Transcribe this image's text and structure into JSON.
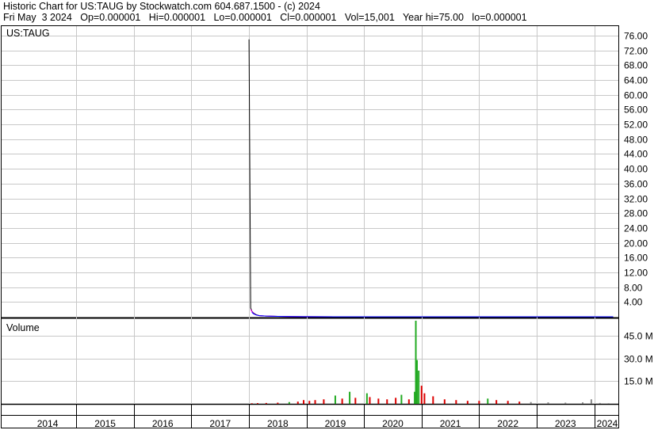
{
  "header": {
    "line1": "Historic Chart for US:TAUG by Stockwatch.com 604.687.1500 - (c) 2024",
    "line2": "Fri May  3 2024   Op=0.000001   Hi=0.000001   Lo=0.000001   Cl=0.000001   Vol=15,001   Year hi=75.00   lo=0.000001"
  },
  "chart_data": [
    {
      "type": "line",
      "title": "US:TAUG",
      "yticks": [
        "76.00",
        "72.00",
        "68.00",
        "64.00",
        "60.00",
        "56.00",
        "52.00",
        "48.00",
        "44.00",
        "40.00",
        "36.00",
        "32.00",
        "28.00",
        "24.00",
        "20.00",
        "16.00",
        "12.00",
        "8.00",
        "4.00"
      ],
      "ylim": [
        0,
        77.5
      ],
      "grid": true,
      "x": [
        2018.0,
        2018.03,
        2018.05,
        2018.08,
        2018.12,
        2018.18,
        2018.3,
        2018.5,
        2018.75,
        2019.0,
        2019.5,
        2020.0,
        2020.5,
        2021.0,
        2021.5,
        2022.0,
        2022.5,
        2023.0,
        2023.5,
        2024.0,
        2024.33
      ],
      "series": [
        {
          "values": [
            75.0,
            2.4,
            1.5,
            1.0,
            0.6,
            0.3,
            0.2,
            0.1,
            0.05,
            0.02,
            0.01,
            0.005,
            0.004,
            0.003,
            0.002,
            0.001,
            0.001,
            0.0005,
            0.0002,
            1e-05,
            1e-06
          ],
          "color": "#000000"
        },
        {
          "values": [
            null,
            2.0,
            1.4,
            0.9,
            0.5,
            0.3,
            0.2,
            0.1,
            0.05,
            0.02,
            0.01,
            0.005,
            0.004,
            0.003,
            0.002,
            0.001,
            0.001,
            0.0005,
            0.0002,
            1e-05,
            1e-06
          ],
          "color": "#ff00ff"
        },
        {
          "values": [
            null,
            null,
            1.2,
            0.8,
            0.5,
            0.3,
            0.2,
            0.1,
            0.05,
            0.02,
            0.01,
            0.005,
            0.004,
            0.003,
            0.002,
            0.001,
            0.001,
            0.0005,
            0.0002,
            1e-05,
            1e-06
          ],
          "color": "#0000ff"
        }
      ]
    },
    {
      "type": "bar",
      "title": "Volume",
      "yticks": [
        "45.0 M",
        "30.0 M",
        "15.0 M"
      ],
      "ylim": [
        0,
        55
      ],
      "colors": {
        "up": "#22aa22",
        "down": "#dd0000",
        "flat": "#888888"
      },
      "bars": [
        {
          "x": 2018.05,
          "v": 0.4,
          "c": "down"
        },
        {
          "x": 2018.15,
          "v": 0.5,
          "c": "down"
        },
        {
          "x": 2018.3,
          "v": 0.6,
          "c": "down"
        },
        {
          "x": 2018.5,
          "v": 0.8,
          "c": "down"
        },
        {
          "x": 2018.7,
          "v": 1.2,
          "c": "up"
        },
        {
          "x": 2018.85,
          "v": 1.5,
          "c": "down"
        },
        {
          "x": 2018.95,
          "v": 2.5,
          "c": "down"
        },
        {
          "x": 2019.05,
          "v": 2.0,
          "c": "down"
        },
        {
          "x": 2019.15,
          "v": 2.5,
          "c": "down"
        },
        {
          "x": 2019.3,
          "v": 3.0,
          "c": "down"
        },
        {
          "x": 2019.5,
          "v": 5.5,
          "c": "up"
        },
        {
          "x": 2019.62,
          "v": 3.5,
          "c": "down"
        },
        {
          "x": 2019.75,
          "v": 8.0,
          "c": "up"
        },
        {
          "x": 2019.85,
          "v": 4.0,
          "c": "down"
        },
        {
          "x": 2020.05,
          "v": 7.0,
          "c": "up"
        },
        {
          "x": 2020.1,
          "v": 4.5,
          "c": "down"
        },
        {
          "x": 2020.25,
          "v": 3.5,
          "c": "down"
        },
        {
          "x": 2020.4,
          "v": 3.0,
          "c": "down"
        },
        {
          "x": 2020.55,
          "v": 4.0,
          "c": "down"
        },
        {
          "x": 2020.65,
          "v": 6.0,
          "c": "up"
        },
        {
          "x": 2020.78,
          "v": 3.0,
          "c": "down"
        },
        {
          "x": 2020.88,
          "v": 8.0,
          "c": "up"
        },
        {
          "x": 2020.9,
          "v": 55.0,
          "c": "up"
        },
        {
          "x": 2020.92,
          "v": 29.0,
          "c": "up"
        },
        {
          "x": 2020.95,
          "v": 22.0,
          "c": "up"
        },
        {
          "x": 2021.0,
          "v": 12.0,
          "c": "down"
        },
        {
          "x": 2021.05,
          "v": 7.0,
          "c": "down"
        },
        {
          "x": 2021.2,
          "v": 5.0,
          "c": "down"
        },
        {
          "x": 2021.4,
          "v": 3.0,
          "c": "down"
        },
        {
          "x": 2021.6,
          "v": 2.5,
          "c": "down"
        },
        {
          "x": 2021.8,
          "v": 2.0,
          "c": "down"
        },
        {
          "x": 2022.0,
          "v": 2.0,
          "c": "down"
        },
        {
          "x": 2022.15,
          "v": 3.5,
          "c": "up"
        },
        {
          "x": 2022.3,
          "v": 2.5,
          "c": "down"
        },
        {
          "x": 2022.5,
          "v": 2.0,
          "c": "down"
        },
        {
          "x": 2022.7,
          "v": 1.5,
          "c": "down"
        },
        {
          "x": 2022.9,
          "v": 1.2,
          "c": "flat"
        },
        {
          "x": 2023.2,
          "v": 1.0,
          "c": "flat"
        },
        {
          "x": 2023.5,
          "v": 0.8,
          "c": "flat"
        },
        {
          "x": 2023.8,
          "v": 1.0,
          "c": "flat"
        },
        {
          "x": 2023.95,
          "v": 3.0,
          "c": "flat"
        },
        {
          "x": 2024.1,
          "v": 0.6,
          "c": "flat"
        },
        {
          "x": 2024.25,
          "v": 0.4,
          "c": "flat"
        }
      ]
    }
  ],
  "xaxis": {
    "labels": [
      "2014",
      "2015",
      "2016",
      "2017",
      "2018",
      "2019",
      "2020",
      "2021",
      "2022",
      "2023",
      "2024"
    ],
    "range": [
      2013.7,
      2024.42
    ]
  }
}
